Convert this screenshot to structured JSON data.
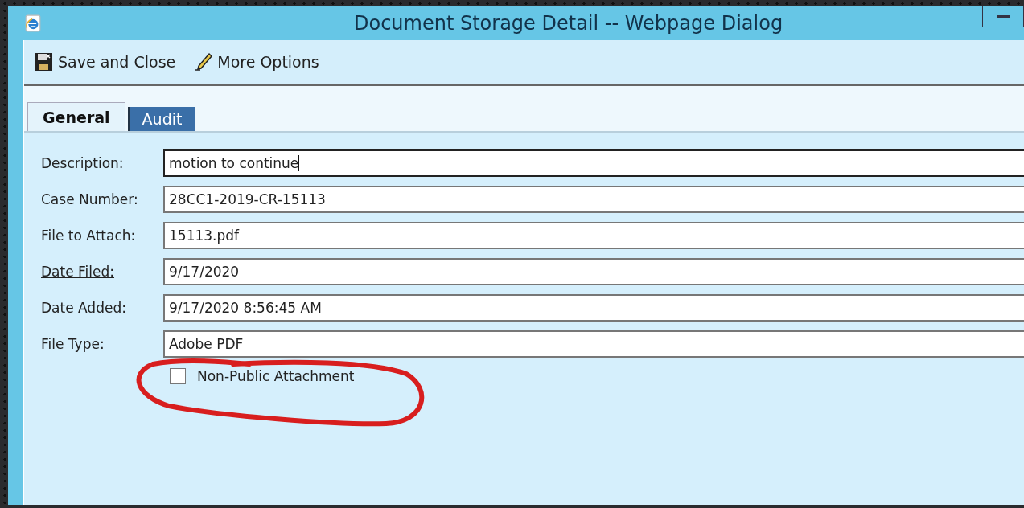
{
  "window": {
    "title": "Document Storage Detail -- Webpage Dialog"
  },
  "toolbar": [
    {
      "kind": "save",
      "label": "Save and Close"
    },
    {
      "kind": "edit",
      "label": "More Options"
    }
  ],
  "tabs": [
    {
      "label": "General",
      "selected": true
    },
    {
      "label": "Audit",
      "selected": false
    }
  ],
  "fields": [
    {
      "label": "Description:",
      "value": "motion to continue",
      "link": false,
      "focused": true
    },
    {
      "label": "Case Number:",
      "value": "28CC1-2019-CR-15113",
      "link": false,
      "focused": false
    },
    {
      "label": "File to Attach:",
      "value": "15113.pdf",
      "link": false,
      "focused": false
    },
    {
      "label": "Date Filed:",
      "value": "9/17/2020",
      "link": true,
      "focused": false
    },
    {
      "label": "Date Added:",
      "value": "9/17/2020 8:56:45 AM",
      "link": false,
      "focused": false
    },
    {
      "label": "File Type:",
      "value": "Adobe PDF",
      "link": false,
      "focused": false
    }
  ],
  "checkbox": {
    "label": "Non-Public Attachment",
    "checked": false
  }
}
